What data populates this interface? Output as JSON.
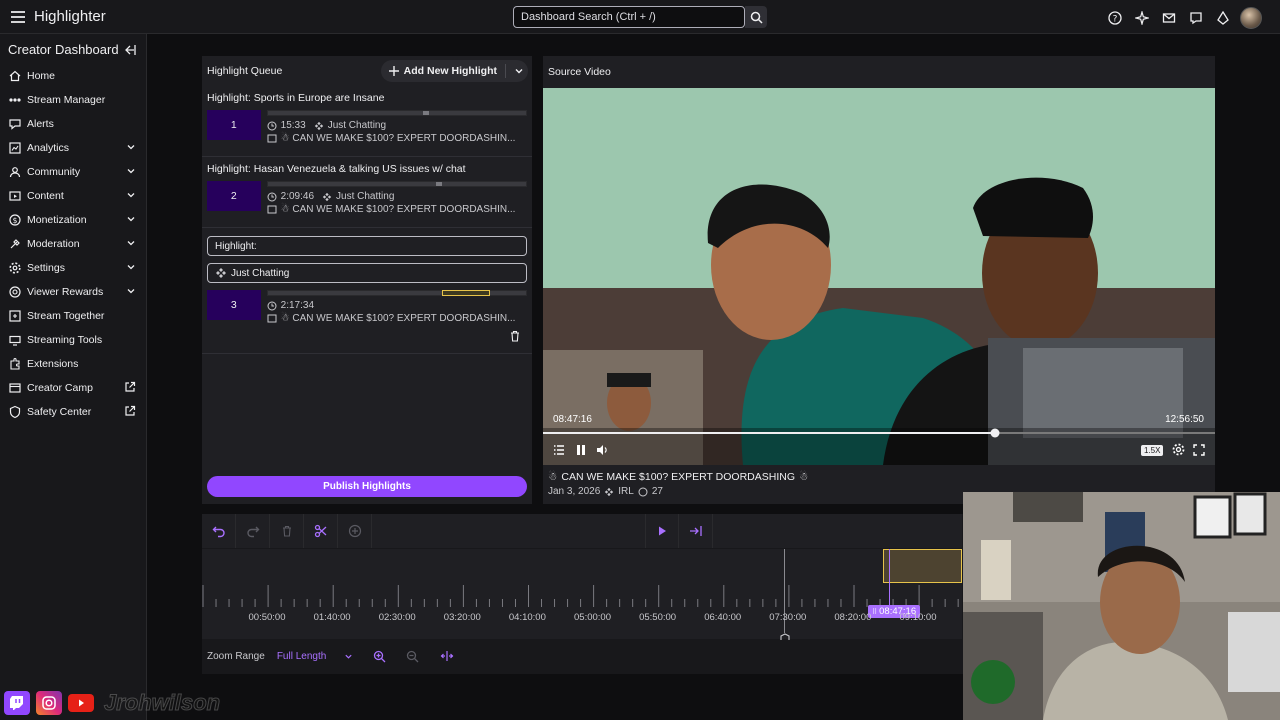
{
  "app": {
    "title": "Highlighter"
  },
  "search": {
    "placeholder": "Dashboard Search (Ctrl + /)"
  },
  "sidebar": {
    "header": "Creator Dashboard",
    "items": [
      {
        "label": "Home",
        "icon": "home-icon",
        "expandable": false
      },
      {
        "label": "Stream Manager",
        "icon": "stream-manager-icon",
        "expandable": false
      },
      {
        "label": "Alerts",
        "icon": "alerts-icon",
        "expandable": false
      },
      {
        "label": "Analytics",
        "icon": "analytics-icon",
        "expandable": true
      },
      {
        "label": "Community",
        "icon": "community-icon",
        "expandable": true
      },
      {
        "label": "Content",
        "icon": "content-icon",
        "expandable": true
      },
      {
        "label": "Monetization",
        "icon": "monetization-icon",
        "expandable": true
      },
      {
        "label": "Moderation",
        "icon": "moderation-icon",
        "expandable": true
      },
      {
        "label": "Settings",
        "icon": "settings-icon",
        "expandable": true
      },
      {
        "label": "Viewer Rewards",
        "icon": "viewer-rewards-icon",
        "expandable": true
      },
      {
        "label": "Stream Together",
        "icon": "stream-together-icon",
        "expandable": false
      },
      {
        "label": "Streaming Tools",
        "icon": "streaming-tools-icon",
        "expandable": false
      },
      {
        "label": "Extensions",
        "icon": "extensions-icon",
        "expandable": false
      },
      {
        "label": "Creator Camp",
        "icon": "creator-camp-icon",
        "external": true
      },
      {
        "label": "Safety Center",
        "icon": "safety-center-icon",
        "external": true
      }
    ]
  },
  "queue": {
    "title": "Highlight Queue",
    "add_label": "Add New Highlight",
    "items": [
      {
        "title": "Highlight: Sports in Europe are Insane",
        "number": "1",
        "duration": "15:33",
        "category": "Just Chatting",
        "stream_title": "CAN WE MAKE $100? EXPERT DOORDASHIN...",
        "segment_pos": 0.6
      },
      {
        "title": "Highlight: Hasan Venezuela & talking US issues w/ chat",
        "number": "2",
        "duration": "2:09:46",
        "category": "Just Chatting",
        "stream_title": "CAN WE MAKE $100? EXPERT DOORDASHIN...",
        "segment_pos": 0.65
      }
    ],
    "editing": {
      "title_value": "Highlight:",
      "category_value": "Just Chatting",
      "number": "3",
      "duration": "2:17:34",
      "stream_title": "CAN WE MAKE $100? EXPERT DOORDASHIN..."
    },
    "publish_label": "Publish Highlights"
  },
  "source": {
    "title": "Source Video",
    "current_time": "08:47:16",
    "end_time": "12:56:50",
    "progress": 0.68,
    "speed": "1.5X",
    "stream_title": "CAN WE MAKE $100? EXPERT DOORDASHING",
    "date": "Jan 3, 2026",
    "category": "IRL",
    "views": "27"
  },
  "timeline": {
    "ticks": [
      "00:50:00",
      "01:40:00",
      "02:30:00",
      "03:20:00",
      "04:10:00",
      "05:00:00",
      "05:50:00",
      "06:40:00",
      "07:30:00",
      "08:20:00",
      "09:10:00"
    ],
    "playhead_label": "08:47:16",
    "zoom_label": "Zoom Range",
    "zoom_value": "Full Length"
  },
  "overlay": {
    "handle": "Jrohwilson"
  },
  "colors": {
    "accent": "#9147ff",
    "accent_light": "#a970ff",
    "highlight_yellow": "#e6c34a",
    "number_bg": "#26005c"
  }
}
